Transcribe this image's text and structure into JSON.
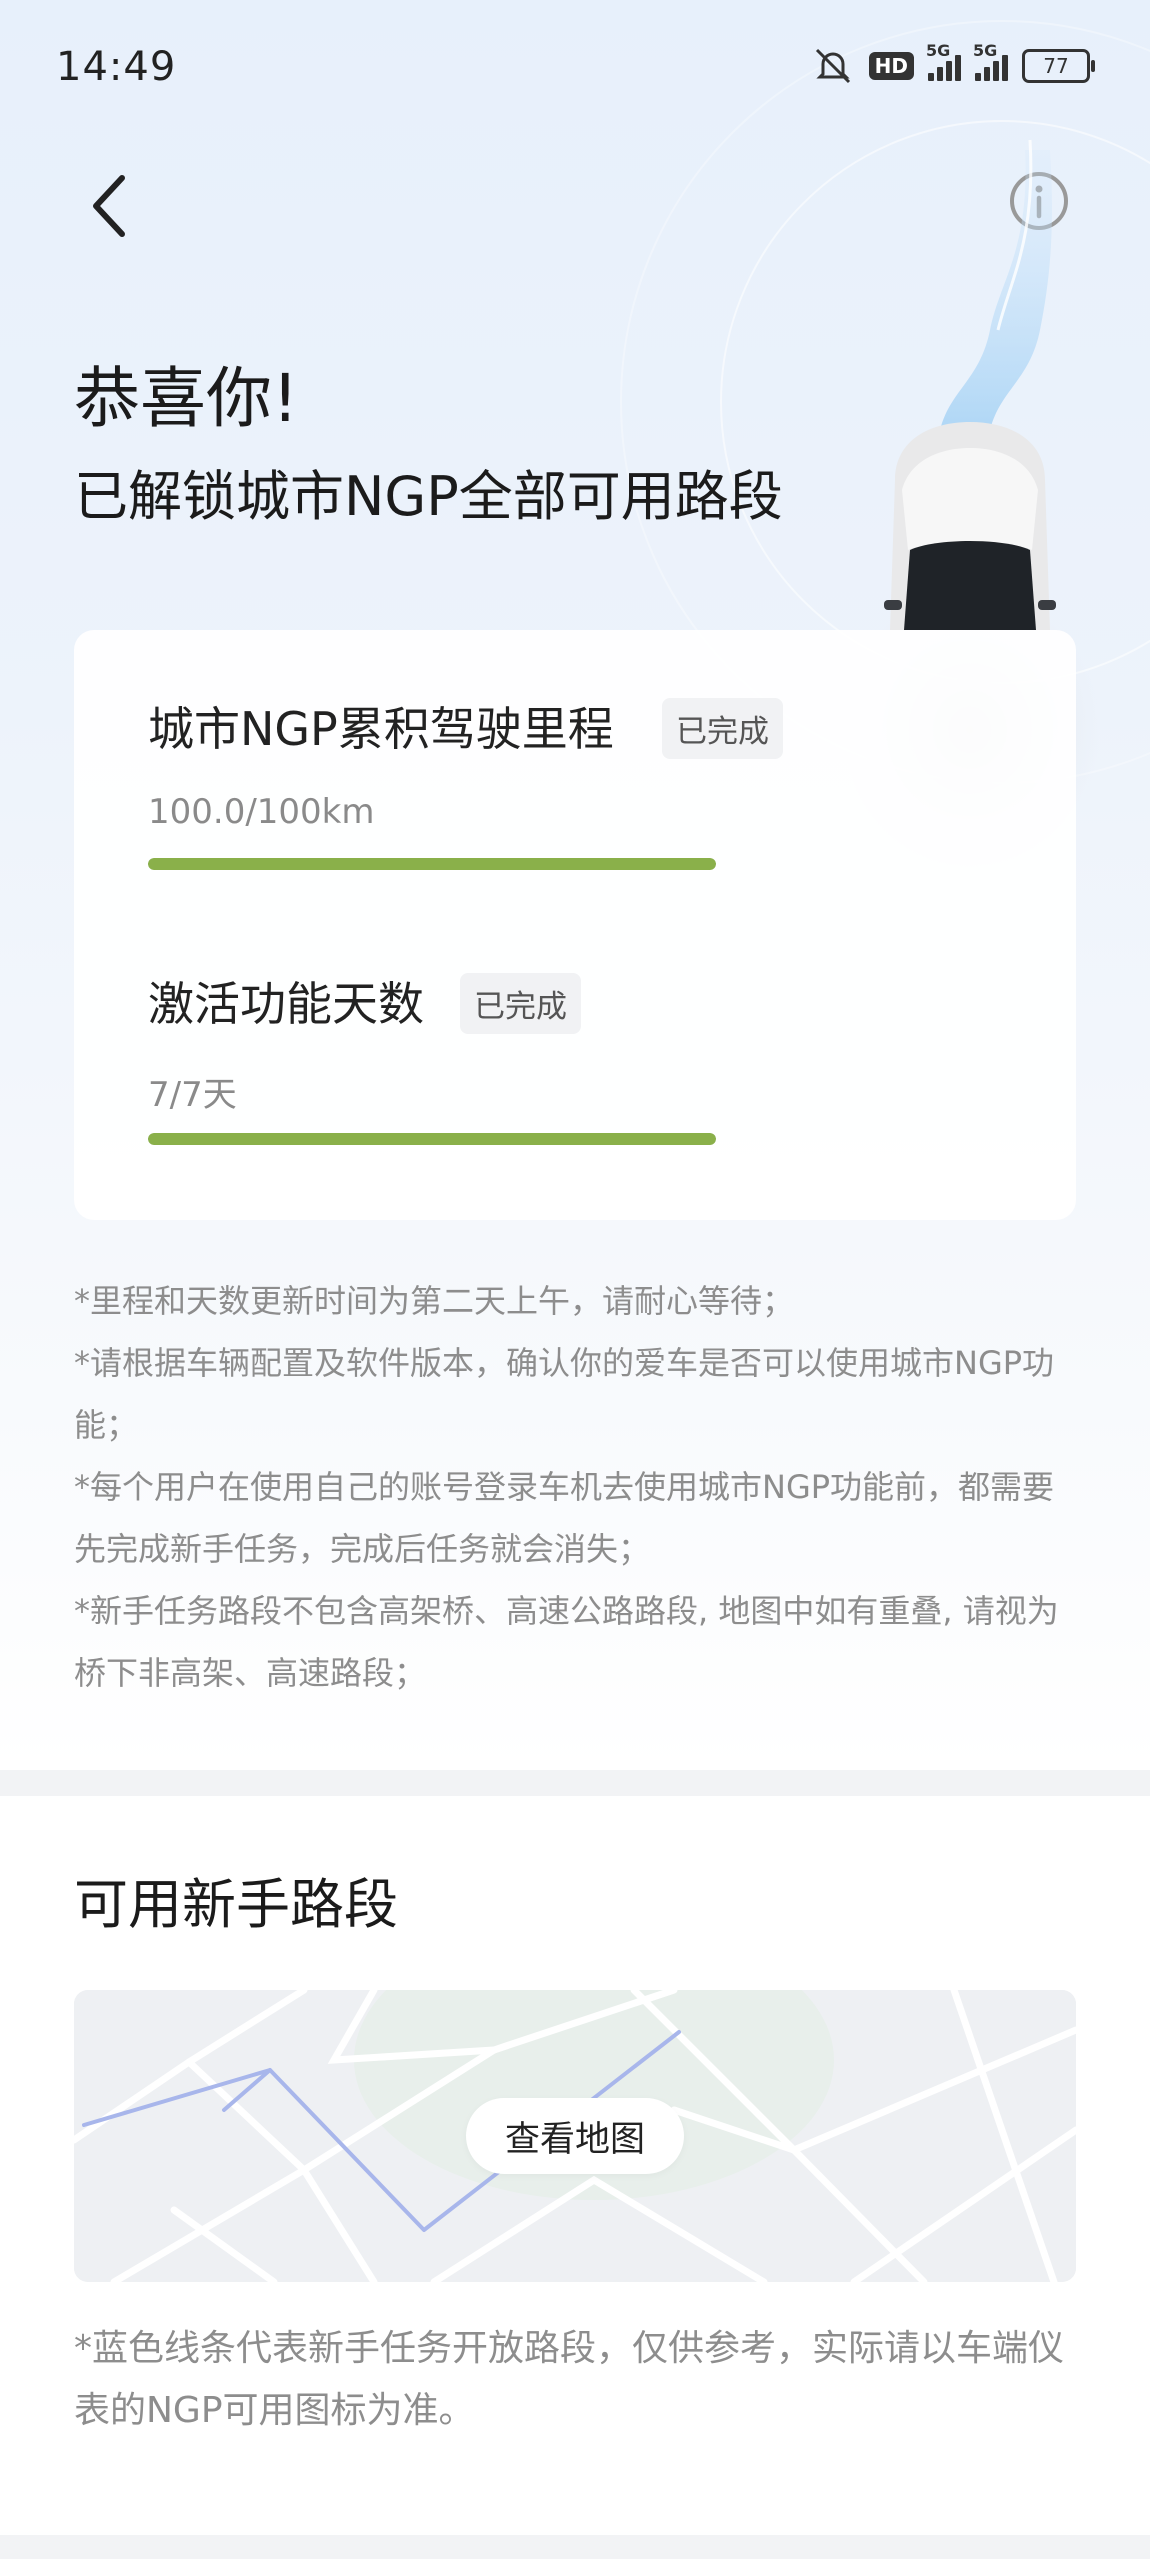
{
  "status_bar": {
    "time": "14:49",
    "network_1": "5G",
    "network_2": "5G",
    "hd": "HD",
    "battery": "77"
  },
  "header": {
    "back_icon": "chevron-left-icon",
    "info_icon": "info-circle-icon"
  },
  "hero": {
    "title": "恭喜你!",
    "subtitle": "已解锁城市NGP全部可用路段"
  },
  "tasks": [
    {
      "label": "城市NGP累积驾驶里程",
      "status": "已完成",
      "value": "100.0/100km",
      "progress": 1.0
    },
    {
      "label": "激活功能天数",
      "status": "已完成",
      "value": "7/7天",
      "progress": 1.0
    }
  ],
  "notes": [
    "*里程和天数更新时间为第二天上午，请耐心等待；",
    "*请根据车辆配置及软件版本，确认你的爱车是否可以使用城市NGP功能；",
    "*每个用户在使用自己的账号登录车机去使用城市NGP功能前，都需要先完成新手任务，完成后任务就会消失；",
    "*新手任务路段不包含高架桥、高速公路路段, 地图中如有重叠, 请视为桥下非高架、高速路段；"
  ],
  "map_section": {
    "title": "可用新手路段",
    "button_label": "查看地图",
    "footnote": "*蓝色线条代表新手任务开放路段，仅供参考，实际请以车端仪表的NGP可用图标为准。"
  },
  "colors": {
    "progress_green": "#8ab04a",
    "route_blue": "#8fa6ea",
    "hero_bg": "#e7f0fb"
  }
}
